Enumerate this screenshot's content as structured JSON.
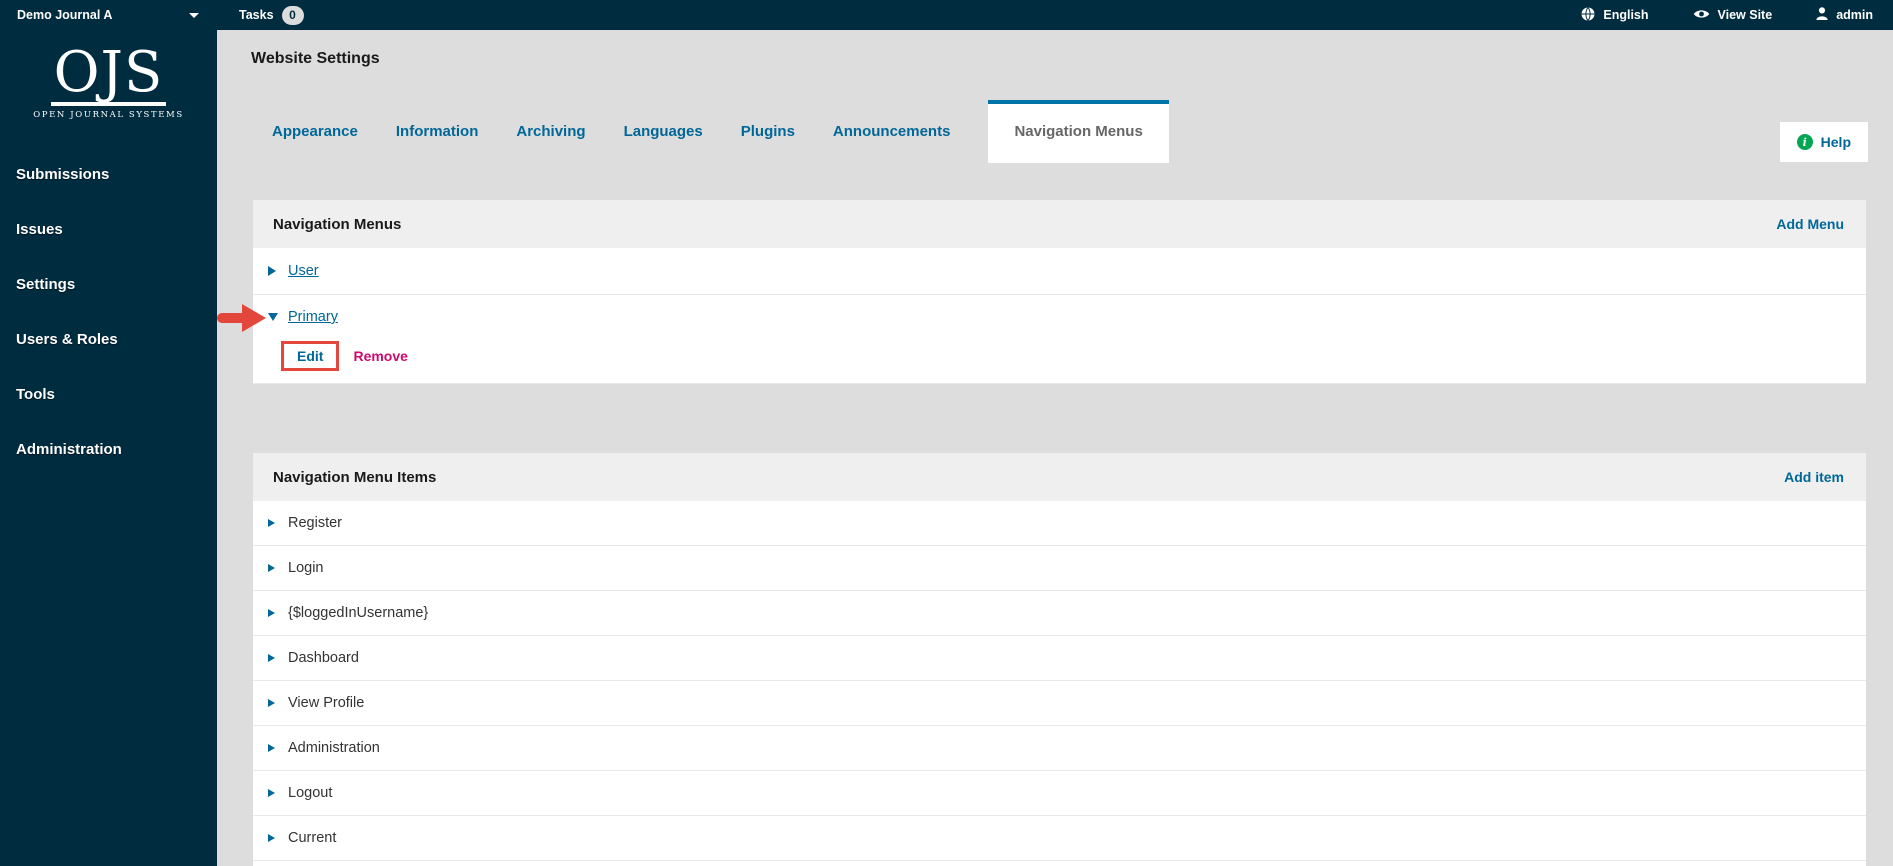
{
  "topbar": {
    "journal_name": "Demo Journal A",
    "tasks_label": "Tasks",
    "tasks_count": "0",
    "language": "English",
    "view_site": "View Site",
    "username": "admin"
  },
  "sidebar": {
    "logo": "OJS",
    "tagline": "OPEN JOURNAL SYSTEMS",
    "items": [
      "Submissions",
      "Issues",
      "Settings",
      "Users & Roles",
      "Tools",
      "Administration"
    ]
  },
  "header": {
    "page_title": "Website Settings",
    "tabs": [
      "Appearance",
      "Information",
      "Archiving",
      "Languages",
      "Plugins",
      "Announcements"
    ],
    "active_tab": "Navigation Menus",
    "help_label": "Help"
  },
  "menus_panel": {
    "title": "Navigation Menus",
    "add_label": "Add Menu",
    "menus": [
      {
        "label": "User",
        "expanded": false
      },
      {
        "label": "Primary",
        "expanded": true
      }
    ],
    "edit_label": "Edit",
    "remove_label": "Remove"
  },
  "items_panel": {
    "title": "Navigation Menu Items",
    "add_label": "Add item",
    "items": [
      "Register",
      "Login",
      "{$loggedInUsername}",
      "Dashboard",
      "View Profile",
      "Administration",
      "Logout",
      "Current"
    ]
  },
  "colors": {
    "navy": "#002c40",
    "link_blue": "#006798",
    "active_tab_border": "#0073a7",
    "active_tab_text": "#666666",
    "remove_pink": "#d00a6c",
    "annotation_red": "#e3463a",
    "help_green": "#00a651",
    "page_bg": "#dddddd",
    "panel_header_bg": "#efefef"
  }
}
